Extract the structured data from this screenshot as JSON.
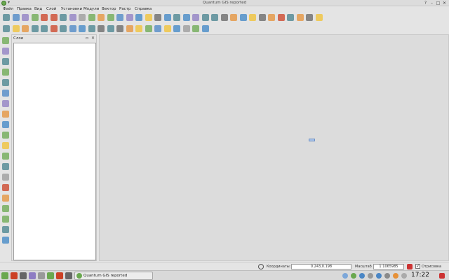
{
  "window": {
    "title": "Quantum GIS reported",
    "controls": [
      "?",
      "–",
      "□",
      "✕"
    ]
  },
  "menubar": {
    "items": [
      "Файл",
      "Правка",
      "Вид",
      "Слой",
      "Установки",
      "Модули",
      "Вектор",
      "Растр",
      "Справка"
    ]
  },
  "layers_panel": {
    "title": "Слои",
    "float_glyph": "▫",
    "close_glyph": "✕"
  },
  "statusbar": {
    "coord_label": "Координаты:",
    "coord_value": "0.243,0.198",
    "scale_label": "Масштаб",
    "scale_value": "1:1065985",
    "render_label": "Отрисовка"
  },
  "taskbar": {
    "task_label": "Quantum GIS reported",
    "clock": "17:22"
  },
  "colors": {
    "accent": "#3d7a2a",
    "map_bg": "#dcdcdc",
    "panel_bg": "#e4e4e4"
  },
  "icons": {
    "toolbar1": [
      "new-project-icon",
      "open-project-icon",
      "save-project-icon",
      "save-as-icon",
      "new-print-composer-icon",
      "print-icon",
      "pan-icon",
      "zoom-in-icon",
      "zoom-out-icon",
      "zoom-full-icon",
      "zoom-to-selection-icon",
      "zoom-to-layer-icon",
      "zoom-last-icon",
      "zoom-next-icon",
      "refresh-icon",
      "identify-icon",
      "select-icon",
      "deselect-icon",
      "measure-icon",
      "measure-area-icon",
      "map-tips-icon",
      "bookmark-icon",
      "text-annotation-icon",
      "form-annotation-icon",
      "label-icon",
      "python-console-icon",
      "grass-icon",
      "osm-icon",
      "gps-icon",
      "georeferencer-icon",
      "web-service-icon",
      "tile-icon",
      "coordinate-capture-icon",
      "help-icon"
    ],
    "toolbar2": [
      "toggle-edit-icon",
      "save-edits-icon",
      "add-feature-icon",
      "move-feature-icon",
      "node-tool-icon",
      "delete-selected-icon",
      "cut-icon",
      "copy-icon",
      "paste-icon",
      "undo-icon",
      "redo-icon",
      "simplify-icon",
      "add-ring-icon",
      "add-part-icon",
      "delete-ring-icon",
      "delete-part-icon",
      "reshape-icon",
      "offset-curve-icon",
      "split-icon",
      "merge-icon",
      "merge-attributes-icon",
      "rotate-icon"
    ],
    "left_toolbar": [
      "add-vector-layer-icon",
      "add-raster-layer-icon",
      "add-postgis-layer-icon",
      "add-spatialite-layer-icon",
      "add-wms-layer-icon",
      "add-mssql-layer-icon",
      "add-oracle-layer-icon",
      "add-wcs-layer-icon",
      "add-wfs-layer-icon",
      "add-delimited-text-icon",
      "new-shapefile-icon",
      "new-spatialite-icon",
      "new-gpx-icon",
      "new-memory-layer-icon",
      "remove-layer-icon",
      "add-gpx-icon",
      "add-text-layer-icon",
      "add-wms-tile-icon",
      "add-vector-tile-icon",
      "embed-layer-icon"
    ],
    "taskbar": [
      "kde-menu-icon",
      "file-manager-icon",
      "firefox-icon",
      "pidgin-icon",
      "kontact-icon",
      "monitor-icon",
      "terminal-icon",
      "desktop-pager-icon"
    ]
  }
}
